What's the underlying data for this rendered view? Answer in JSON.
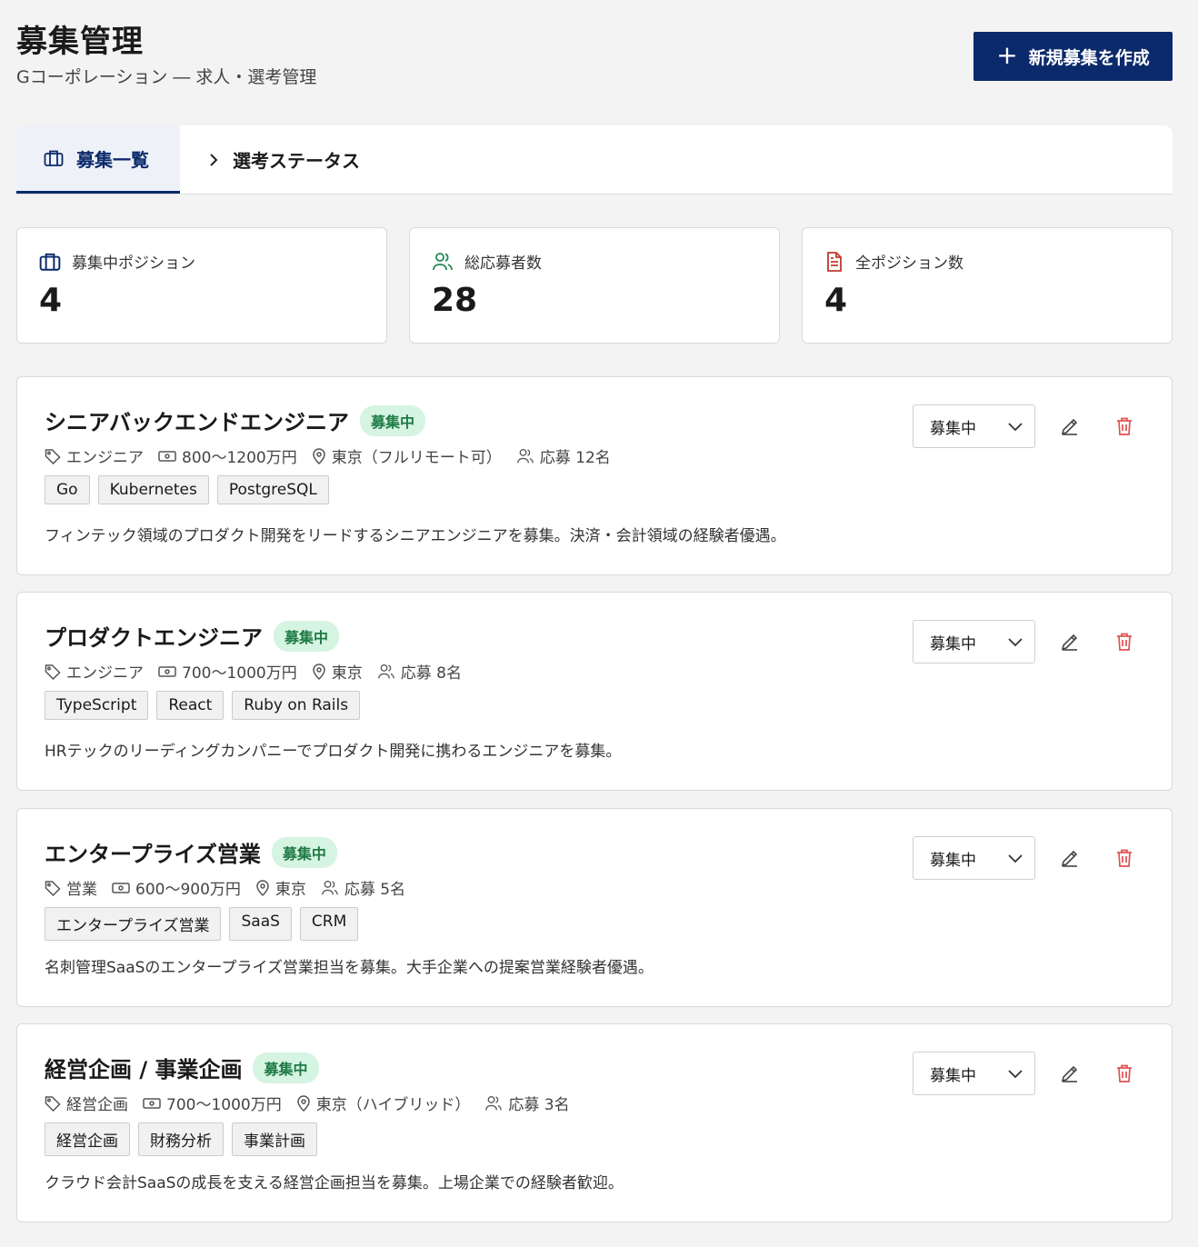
{
  "header": {
    "title": "募集管理",
    "subtitle": "Gコーポレーション ― 求人・選考管理",
    "new_button": "新規募集を作成"
  },
  "tabs": [
    {
      "label": "募集一覧",
      "icon": "briefcase-icon",
      "active": true
    },
    {
      "label": "選考ステータス",
      "icon": "chevron-right-icon",
      "active": false
    }
  ],
  "stats": [
    {
      "label": "募集中ポジション",
      "value": "4",
      "icon": "briefcase-icon",
      "color": "#0b2a6b"
    },
    {
      "label": "総応募者数",
      "value": "28",
      "icon": "users-icon",
      "color": "#1e8a50"
    },
    {
      "label": "全ポジション数",
      "value": "4",
      "icon": "document-icon",
      "color": "#c0392b"
    }
  ],
  "jobs": [
    {
      "title": "シニアバックエンドエンジニア",
      "status": "募集中",
      "category": "エンジニア",
      "salary": "800〜1200万円",
      "location": "東京（フルリモート可）",
      "applicants": "応募 12名",
      "tags": [
        "Go",
        "Kubernetes",
        "PostgreSQL"
      ],
      "description": "フィンテック領域のプロダクト開発をリードするシニアエンジニアを募集。決済・会計領域の経験者優遇。",
      "select_value": "募集中"
    },
    {
      "title": "プロダクトエンジニア",
      "status": "募集中",
      "category": "エンジニア",
      "salary": "700〜1000万円",
      "location": "東京",
      "applicants": "応募 8名",
      "tags": [
        "TypeScript",
        "React",
        "Ruby on Rails"
      ],
      "description": "HRテックのリーディングカンパニーでプロダクト開発に携わるエンジニアを募集。",
      "select_value": "募集中"
    },
    {
      "title": "エンタープライズ営業",
      "status": "募集中",
      "category": "営業",
      "salary": "600〜900万円",
      "location": "東京",
      "applicants": "応募 5名",
      "tags": [
        "エンタープライズ営業",
        "SaaS",
        "CRM"
      ],
      "description": "名刺管理SaaSのエンタープライズ営業担当を募集。大手企業への提案営業経験者優遇。",
      "select_value": "募集中"
    },
    {
      "title": "経営企画 / 事業企画",
      "status": "募集中",
      "category": "経営企画",
      "salary": "700〜1000万円",
      "location": "東京（ハイブリッド）",
      "applicants": "応募 3名",
      "tags": [
        "経営企画",
        "財務分析",
        "事業計画"
      ],
      "description": "クラウド会計SaaSの成長を支える経営企画担当を募集。上場企業での経験者歓迎。",
      "select_value": "募集中"
    }
  ],
  "colors": {
    "primary": "#0b2a6b",
    "badge_bg": "#d6f4e2",
    "badge_text": "#1e7a45",
    "danger": "#e05050"
  }
}
